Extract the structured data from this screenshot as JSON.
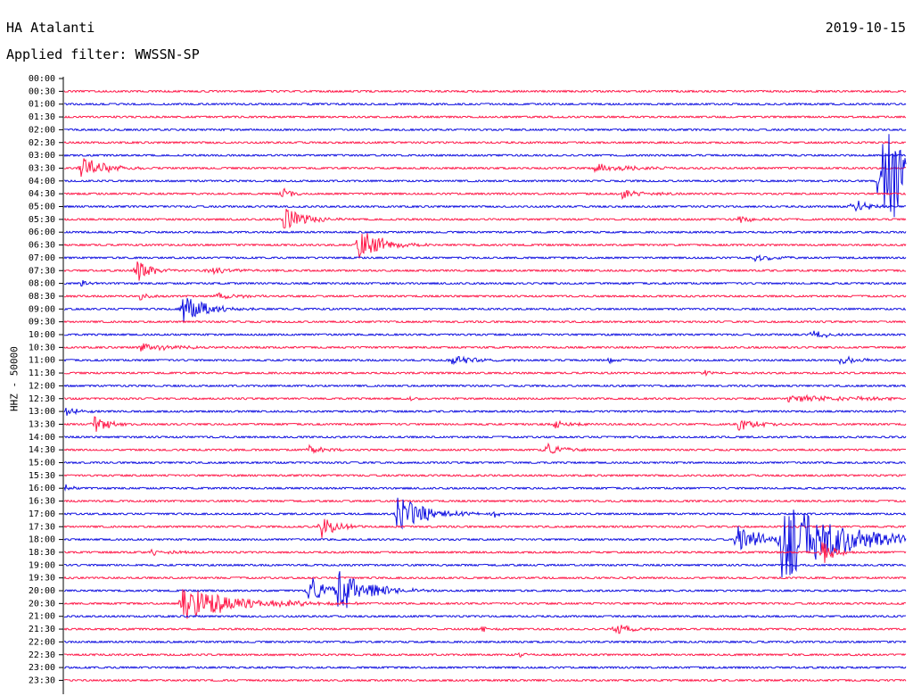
{
  "header": {
    "station": "HA Atalanti",
    "filter": "Applied filter: WWSSN-SP",
    "date": "2019-10-15"
  },
  "chart_data": {
    "type": "line",
    "ylabel": "HHZ - 50000",
    "row_interval_minutes": 30,
    "colors": {
      "even": "#1010e0",
      "odd": "#ff1a4a"
    },
    "time_labels": [
      "00:00",
      "00:30",
      "01:00",
      "01:30",
      "02:00",
      "02:30",
      "03:00",
      "03:30",
      "04:00",
      "04:30",
      "05:00",
      "05:30",
      "06:00",
      "06:30",
      "07:00",
      "07:30",
      "08:00",
      "08:30",
      "09:00",
      "09:30",
      "10:00",
      "10:30",
      "11:00",
      "11:30",
      "12:00",
      "12:30",
      "13:00",
      "13:30",
      "14:00",
      "14:30",
      "15:00",
      "15:30",
      "16:00",
      "16:30",
      "17:00",
      "17:30",
      "18:00",
      "18:30",
      "19:00",
      "19:30",
      "20:00",
      "20:30",
      "21:00",
      "21:30",
      "22:00",
      "22:30",
      "23:00",
      "23:30"
    ],
    "events": [
      {
        "row": 7,
        "x": 0.02,
        "amp": 1.6,
        "dur": 0.03
      },
      {
        "row": 9,
        "x": 0.26,
        "amp": 1.3,
        "dur": 0.01
      },
      {
        "row": 9,
        "x": 0.66,
        "amp": 0.7,
        "dur": 0.03
      },
      {
        "row": 7,
        "x": 0.63,
        "amp": 0.6,
        "dur": 0.05
      },
      {
        "row": 8,
        "x": 0.97,
        "amp": 8.0,
        "dur": 0.06
      },
      {
        "row": 10,
        "x": 0.935,
        "amp": 1.2,
        "dur": 0.02
      },
      {
        "row": 11,
        "x": 0.26,
        "amp": 1.5,
        "dur": 0.03
      },
      {
        "row": 11,
        "x": 0.8,
        "amp": 0.6,
        "dur": 0.02
      },
      {
        "row": 13,
        "x": 0.35,
        "amp": 2.5,
        "dur": 0.03
      },
      {
        "row": 14,
        "x": 0.82,
        "amp": 0.7,
        "dur": 0.02
      },
      {
        "row": 15,
        "x": 0.085,
        "amp": 1.6,
        "dur": 0.02
      },
      {
        "row": 15,
        "x": 0.17,
        "amp": 0.4,
        "dur": 0.05
      },
      {
        "row": 16,
        "x": 0.02,
        "amp": 0.5,
        "dur": 0.01
      },
      {
        "row": 17,
        "x": 0.09,
        "amp": 0.6,
        "dur": 0.01
      },
      {
        "row": 17,
        "x": 0.18,
        "amp": 0.5,
        "dur": 0.03
      },
      {
        "row": 18,
        "x": 0.14,
        "amp": 2.0,
        "dur": 0.03
      },
      {
        "row": 20,
        "x": 0.89,
        "amp": 0.9,
        "dur": 0.015
      },
      {
        "row": 21,
        "x": 0.09,
        "amp": 0.5,
        "dur": 0.05
      },
      {
        "row": 22,
        "x": 0.46,
        "amp": 0.7,
        "dur": 0.03
      },
      {
        "row": 22,
        "x": 0.645,
        "amp": 0.6,
        "dur": 0.01
      },
      {
        "row": 22,
        "x": 0.92,
        "amp": 0.6,
        "dur": 0.03
      },
      {
        "row": 23,
        "x": 0.76,
        "amp": 0.4,
        "dur": 0.01
      },
      {
        "row": 25,
        "x": 0.41,
        "amp": 0.4,
        "dur": 0.01
      },
      {
        "row": 25,
        "x": 0.86,
        "amp": 0.4,
        "dur": 0.12
      },
      {
        "row": 26,
        "x": 0.0,
        "amp": 0.6,
        "dur": 0.02
      },
      {
        "row": 27,
        "x": 0.035,
        "amp": 1.3,
        "dur": 0.02
      },
      {
        "row": 27,
        "x": 0.58,
        "amp": 0.6,
        "dur": 0.02
      },
      {
        "row": 27,
        "x": 0.8,
        "amp": 0.8,
        "dur": 0.03
      },
      {
        "row": 29,
        "x": 0.29,
        "amp": 0.6,
        "dur": 0.02
      },
      {
        "row": 29,
        "x": 0.57,
        "amp": 1.1,
        "dur": 0.02
      },
      {
        "row": 32,
        "x": 0.0,
        "amp": 0.6,
        "dur": 0.01
      },
      {
        "row": 34,
        "x": 0.395,
        "amp": 2.4,
        "dur": 0.04
      },
      {
        "row": 34,
        "x": 0.51,
        "amp": 0.5,
        "dur": 0.01
      },
      {
        "row": 35,
        "x": 0.305,
        "amp": 1.7,
        "dur": 0.02
      },
      {
        "row": 36,
        "x": 0.8,
        "amp": 2.4,
        "dur": 0.03
      },
      {
        "row": 36,
        "x": 0.85,
        "amp": 5.5,
        "dur": 0.08
      },
      {
        "row": 37,
        "x": 0.9,
        "amp": 2.2,
        "dur": 0.015
      },
      {
        "row": 37,
        "x": 0.1,
        "amp": 0.4,
        "dur": 0.03
      },
      {
        "row": 40,
        "x": 0.29,
        "amp": 2.5,
        "dur": 0.02
      },
      {
        "row": 40,
        "x": 0.325,
        "amp": 3.0,
        "dur": 0.04
      },
      {
        "row": 41,
        "x": 0.14,
        "amp": 2.5,
        "dur": 0.07
      },
      {
        "row": 41,
        "x": 0.23,
        "amp": 0.4,
        "dur": 0.03
      },
      {
        "row": 43,
        "x": 0.495,
        "amp": 0.5,
        "dur": 0.01
      },
      {
        "row": 43,
        "x": 0.655,
        "amp": 0.9,
        "dur": 0.02
      },
      {
        "row": 45,
        "x": 0.54,
        "amp": 0.4,
        "dur": 0.01
      }
    ]
  }
}
